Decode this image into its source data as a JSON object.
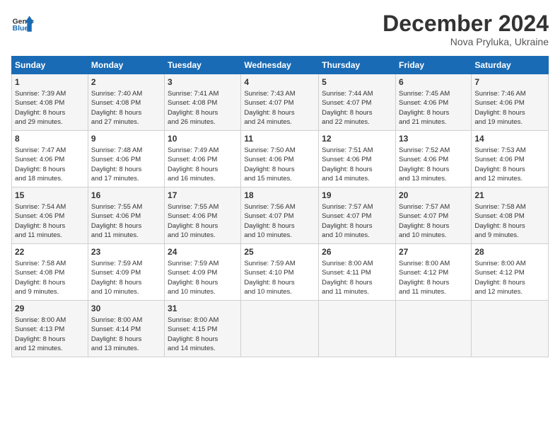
{
  "header": {
    "logo_line1": "General",
    "logo_line2": "Blue",
    "month": "December 2024",
    "location": "Nova Pryluka, Ukraine"
  },
  "weekdays": [
    "Sunday",
    "Monday",
    "Tuesday",
    "Wednesday",
    "Thursday",
    "Friday",
    "Saturday"
  ],
  "weeks": [
    [
      {
        "day": "1",
        "lines": [
          "Sunrise: 7:39 AM",
          "Sunset: 4:08 PM",
          "Daylight: 8 hours",
          "and 29 minutes."
        ]
      },
      {
        "day": "2",
        "lines": [
          "Sunrise: 7:40 AM",
          "Sunset: 4:08 PM",
          "Daylight: 8 hours",
          "and 27 minutes."
        ]
      },
      {
        "day": "3",
        "lines": [
          "Sunrise: 7:41 AM",
          "Sunset: 4:08 PM",
          "Daylight: 8 hours",
          "and 26 minutes."
        ]
      },
      {
        "day": "4",
        "lines": [
          "Sunrise: 7:43 AM",
          "Sunset: 4:07 PM",
          "Daylight: 8 hours",
          "and 24 minutes."
        ]
      },
      {
        "day": "5",
        "lines": [
          "Sunrise: 7:44 AM",
          "Sunset: 4:07 PM",
          "Daylight: 8 hours",
          "and 22 minutes."
        ]
      },
      {
        "day": "6",
        "lines": [
          "Sunrise: 7:45 AM",
          "Sunset: 4:06 PM",
          "Daylight: 8 hours",
          "and 21 minutes."
        ]
      },
      {
        "day": "7",
        "lines": [
          "Sunrise: 7:46 AM",
          "Sunset: 4:06 PM",
          "Daylight: 8 hours",
          "and 19 minutes."
        ]
      }
    ],
    [
      {
        "day": "8",
        "lines": [
          "Sunrise: 7:47 AM",
          "Sunset: 4:06 PM",
          "Daylight: 8 hours",
          "and 18 minutes."
        ]
      },
      {
        "day": "9",
        "lines": [
          "Sunrise: 7:48 AM",
          "Sunset: 4:06 PM",
          "Daylight: 8 hours",
          "and 17 minutes."
        ]
      },
      {
        "day": "10",
        "lines": [
          "Sunrise: 7:49 AM",
          "Sunset: 4:06 PM",
          "Daylight: 8 hours",
          "and 16 minutes."
        ]
      },
      {
        "day": "11",
        "lines": [
          "Sunrise: 7:50 AM",
          "Sunset: 4:06 PM",
          "Daylight: 8 hours",
          "and 15 minutes."
        ]
      },
      {
        "day": "12",
        "lines": [
          "Sunrise: 7:51 AM",
          "Sunset: 4:06 PM",
          "Daylight: 8 hours",
          "and 14 minutes."
        ]
      },
      {
        "day": "13",
        "lines": [
          "Sunrise: 7:52 AM",
          "Sunset: 4:06 PM",
          "Daylight: 8 hours",
          "and 13 minutes."
        ]
      },
      {
        "day": "14",
        "lines": [
          "Sunrise: 7:53 AM",
          "Sunset: 4:06 PM",
          "Daylight: 8 hours",
          "and 12 minutes."
        ]
      }
    ],
    [
      {
        "day": "15",
        "lines": [
          "Sunrise: 7:54 AM",
          "Sunset: 4:06 PM",
          "Daylight: 8 hours",
          "and 11 minutes."
        ]
      },
      {
        "day": "16",
        "lines": [
          "Sunrise: 7:55 AM",
          "Sunset: 4:06 PM",
          "Daylight: 8 hours",
          "and 11 minutes."
        ]
      },
      {
        "day": "17",
        "lines": [
          "Sunrise: 7:55 AM",
          "Sunset: 4:06 PM",
          "Daylight: 8 hours",
          "and 10 minutes."
        ]
      },
      {
        "day": "18",
        "lines": [
          "Sunrise: 7:56 AM",
          "Sunset: 4:07 PM",
          "Daylight: 8 hours",
          "and 10 minutes."
        ]
      },
      {
        "day": "19",
        "lines": [
          "Sunrise: 7:57 AM",
          "Sunset: 4:07 PM",
          "Daylight: 8 hours",
          "and 10 minutes."
        ]
      },
      {
        "day": "20",
        "lines": [
          "Sunrise: 7:57 AM",
          "Sunset: 4:07 PM",
          "Daylight: 8 hours",
          "and 10 minutes."
        ]
      },
      {
        "day": "21",
        "lines": [
          "Sunrise: 7:58 AM",
          "Sunset: 4:08 PM",
          "Daylight: 8 hours",
          "and 9 minutes."
        ]
      }
    ],
    [
      {
        "day": "22",
        "lines": [
          "Sunrise: 7:58 AM",
          "Sunset: 4:08 PM",
          "Daylight: 8 hours",
          "and 9 minutes."
        ]
      },
      {
        "day": "23",
        "lines": [
          "Sunrise: 7:59 AM",
          "Sunset: 4:09 PM",
          "Daylight: 8 hours",
          "and 10 minutes."
        ]
      },
      {
        "day": "24",
        "lines": [
          "Sunrise: 7:59 AM",
          "Sunset: 4:09 PM",
          "Daylight: 8 hours",
          "and 10 minutes."
        ]
      },
      {
        "day": "25",
        "lines": [
          "Sunrise: 7:59 AM",
          "Sunset: 4:10 PM",
          "Daylight: 8 hours",
          "and 10 minutes."
        ]
      },
      {
        "day": "26",
        "lines": [
          "Sunrise: 8:00 AM",
          "Sunset: 4:11 PM",
          "Daylight: 8 hours",
          "and 11 minutes."
        ]
      },
      {
        "day": "27",
        "lines": [
          "Sunrise: 8:00 AM",
          "Sunset: 4:12 PM",
          "Daylight: 8 hours",
          "and 11 minutes."
        ]
      },
      {
        "day": "28",
        "lines": [
          "Sunrise: 8:00 AM",
          "Sunset: 4:12 PM",
          "Daylight: 8 hours",
          "and 12 minutes."
        ]
      }
    ],
    [
      {
        "day": "29",
        "lines": [
          "Sunrise: 8:00 AM",
          "Sunset: 4:13 PM",
          "Daylight: 8 hours",
          "and 12 minutes."
        ]
      },
      {
        "day": "30",
        "lines": [
          "Sunrise: 8:00 AM",
          "Sunset: 4:14 PM",
          "Daylight: 8 hours",
          "and 13 minutes."
        ]
      },
      {
        "day": "31",
        "lines": [
          "Sunrise: 8:00 AM",
          "Sunset: 4:15 PM",
          "Daylight: 8 hours",
          "and 14 minutes."
        ]
      },
      null,
      null,
      null,
      null
    ]
  ]
}
